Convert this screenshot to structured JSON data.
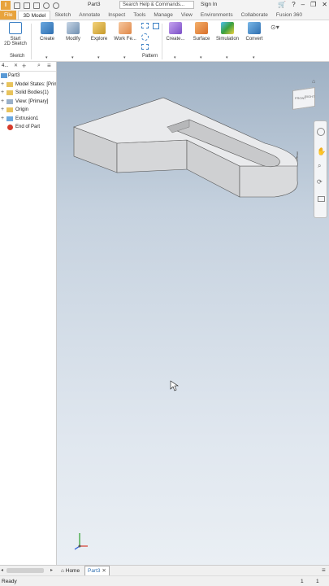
{
  "titlebar": {
    "logo": "I",
    "doc_title": "Part3",
    "search_placeholder": "Search Help & Commands...",
    "sign_in": "Sign In"
  },
  "tabs": [
    "File",
    "3D Model",
    "Sketch",
    "Annotate",
    "Inspect",
    "Tools",
    "Manage",
    "View",
    "Environments",
    "Collaborate",
    "Fusion 360"
  ],
  "ribbon": {
    "start_sketch_line1": "Start",
    "start_sketch_line2": "2D Sketch",
    "sketch_group": "Sketch",
    "create": "Create",
    "modify": "Modify",
    "explore": "Explore",
    "work_features": "Work Fe...",
    "pattern": "Pattern",
    "create_freeform": "Create...",
    "surface": "Surface",
    "simulation": "Simulation",
    "convert": "Convert"
  },
  "browser": {
    "tab_label": "4...",
    "items": [
      {
        "label": "Part3",
        "icon": "part-icon"
      },
      {
        "label": "Model States: [Prima",
        "icon": "folder-icon"
      },
      {
        "label": "Solid Bodies(1)",
        "icon": "folder-icon"
      },
      {
        "label": "View: [Primary]",
        "icon": "view-icon"
      },
      {
        "label": "Origin",
        "icon": "folder-icon"
      },
      {
        "label": "Extrusion1",
        "icon": "extrusion-icon"
      },
      {
        "label": "End of Part",
        "icon": "stop-icon"
      }
    ]
  },
  "viewcube": {
    "front": "FRONT",
    "right": "RIGHT"
  },
  "document_tabs": {
    "home": "Home",
    "part": "Part3"
  },
  "status": {
    "text": "Ready",
    "num1": "1",
    "num2": "1"
  },
  "colors": {
    "accent": "#e8a33d",
    "viewport_top": "#9fb1c4",
    "viewport_bottom": "#eaeff4"
  }
}
